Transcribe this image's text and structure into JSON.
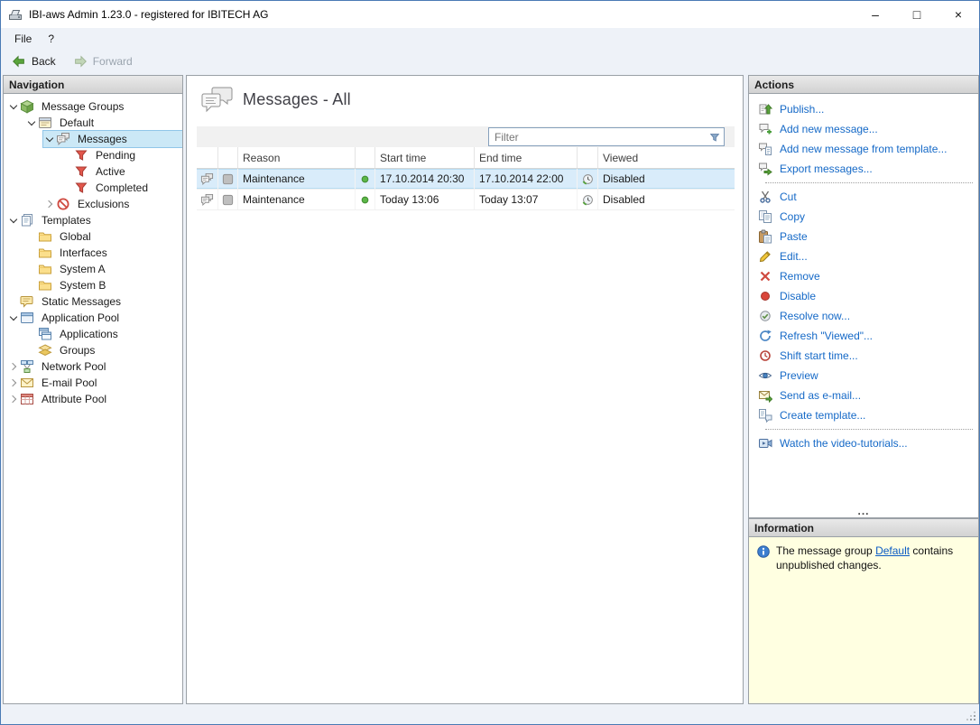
{
  "colors": {
    "action-link": "#1569c7",
    "info-link": "#0b5bc4",
    "tree-selection-bg": "#cbe8f6",
    "row-selection-bg": "#d9ecfa",
    "info-bg": "#ffffe1",
    "status-green": "#5cb648",
    "status-red": "#d9453a"
  },
  "window": {
    "icon": "app-icon",
    "title": "IBI-aws Admin 1.23.0 - registered for IBITECH AG",
    "controls": {
      "minimize": "–",
      "maximize": "□",
      "close": "×"
    }
  },
  "menu": {
    "items": [
      {
        "label": "File"
      },
      {
        "label": "?"
      }
    ]
  },
  "toolbar": {
    "back": {
      "label": "Back",
      "icon": "back-arrow-icon",
      "enabled": true
    },
    "forward": {
      "label": "Forward",
      "icon": "forward-arrow-icon",
      "enabled": false
    }
  },
  "navigation": {
    "header": "Navigation",
    "tree": [
      {
        "label": "Message Groups",
        "depth": 0,
        "chevron": "expanded",
        "icon": "message-groups-icon"
      },
      {
        "label": "Default",
        "depth": 1,
        "chevron": "expanded",
        "icon": "default-group-icon"
      },
      {
        "label": "Messages",
        "depth": 2,
        "chevron": "expanded",
        "icon": "messages-icon",
        "selected": true
      },
      {
        "label": "Pending",
        "depth": 3,
        "chevron": "none",
        "icon": "filter-red-icon"
      },
      {
        "label": "Active",
        "depth": 3,
        "chevron": "none",
        "icon": "filter-red-icon"
      },
      {
        "label": "Completed",
        "depth": 3,
        "chevron": "none",
        "icon": "filter-red-icon"
      },
      {
        "label": "Exclusions",
        "depth": 2,
        "chevron": "collapsed",
        "icon": "exclusions-icon"
      },
      {
        "label": "Templates",
        "depth": 0,
        "chevron": "expanded",
        "icon": "templates-icon"
      },
      {
        "label": "Global",
        "depth": 1,
        "chevron": "none",
        "icon": "folder-icon"
      },
      {
        "label": "Interfaces",
        "depth": 1,
        "chevron": "none",
        "icon": "folder-icon"
      },
      {
        "label": "System A",
        "depth": 1,
        "chevron": "none",
        "icon": "folder-icon"
      },
      {
        "label": "System B",
        "depth": 1,
        "chevron": "none",
        "icon": "folder-icon"
      },
      {
        "label": "Static Messages",
        "depth": 0,
        "chevron": "none",
        "icon": "static-messages-icon"
      },
      {
        "label": "Application Pool",
        "depth": 0,
        "chevron": "expanded",
        "icon": "application-pool-icon"
      },
      {
        "label": "Applications",
        "depth": 1,
        "chevron": "none",
        "icon": "applications-icon"
      },
      {
        "label": "Groups",
        "depth": 1,
        "chevron": "none",
        "icon": "groups-icon"
      },
      {
        "label": "Network Pool",
        "depth": 0,
        "chevron": "collapsed",
        "icon": "network-pool-icon"
      },
      {
        "label": "E-mail Pool",
        "depth": 0,
        "chevron": "collapsed",
        "icon": "email-pool-icon"
      },
      {
        "label": "Attribute Pool",
        "depth": 0,
        "chevron": "collapsed",
        "icon": "attribute-pool-icon"
      }
    ]
  },
  "main": {
    "icon": "messages-large-icon",
    "title": "Messages - All",
    "filter": {
      "placeholder": "Filter",
      "icon": "filter-funnel-icon"
    },
    "table": {
      "columns": [
        "Reason",
        "Start time",
        "End time",
        "Viewed"
      ],
      "row_icons": {
        "message": "message-bubble-icon",
        "state": "gray-square-icon",
        "status": "green-dot-icon",
        "viewed": "viewed-clock-icon"
      },
      "rows": [
        {
          "reason": "Maintenance",
          "start_time": "17.10.2014 20:30",
          "end_time": "17.10.2014 22:00",
          "viewed": "Disabled",
          "selected": true
        },
        {
          "reason": "Maintenance",
          "start_time": "Today 13:06",
          "end_time": "Today 13:07",
          "viewed": "Disabled",
          "selected": false
        }
      ]
    }
  },
  "actions": {
    "header": "Actions",
    "overflow": "...",
    "groups": [
      [
        {
          "label": "Publish...",
          "icon": "publish-icon"
        },
        {
          "label": "Add new message...",
          "icon": "add-message-icon"
        },
        {
          "label": "Add new message from template...",
          "icon": "add-message-template-icon"
        },
        {
          "label": "Export messages...",
          "icon": "export-messages-icon"
        }
      ],
      [
        {
          "label": "Cut",
          "icon": "cut-icon"
        },
        {
          "label": "Copy",
          "icon": "copy-icon"
        },
        {
          "label": "Paste",
          "icon": "paste-icon"
        },
        {
          "label": "Edit...",
          "icon": "edit-icon"
        },
        {
          "label": "Remove",
          "icon": "remove-icon"
        },
        {
          "label": "Disable",
          "icon": "disable-icon"
        },
        {
          "label": "Resolve now...",
          "icon": "resolve-icon"
        },
        {
          "label": "Refresh \"Viewed\"...",
          "icon": "refresh-viewed-icon"
        },
        {
          "label": "Shift start time...",
          "icon": "shift-time-icon"
        },
        {
          "label": "Preview",
          "icon": "preview-icon"
        },
        {
          "label": "Send as e-mail...",
          "icon": "send-email-icon"
        },
        {
          "label": "Create template...",
          "icon": "create-template-icon"
        }
      ],
      [
        {
          "label": "Watch the video-tutorials...",
          "icon": "video-tutorials-icon"
        }
      ]
    ]
  },
  "information": {
    "header": "Information",
    "icon": "info-icon",
    "text_before": "The message group ",
    "link_text": "Default",
    "text_after": " contains unpublished changes."
  }
}
